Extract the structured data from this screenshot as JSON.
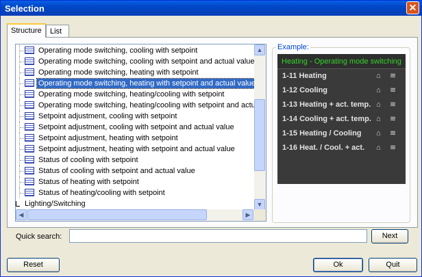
{
  "window": {
    "title": "Selection",
    "close_icon": "close-icon"
  },
  "tabs": [
    {
      "label": "Structure",
      "active": true
    },
    {
      "label": "List",
      "active": false
    }
  ],
  "tree": {
    "items": [
      {
        "label": "Operating mode switching, cooling with setpoint"
      },
      {
        "label": "Operating mode switching, cooling with setpoint and actual value"
      },
      {
        "label": "Operating mode switching, heating with setpoint"
      },
      {
        "label": "Operating mode switching, heating with setpoint and actual value",
        "selected": true
      },
      {
        "label": "Operating mode switching, heating/cooling with setpoint"
      },
      {
        "label": "Operating mode switching, heating/cooling with setpoint and actual value"
      },
      {
        "label": "Setpoint adjustment, cooling with setpoint"
      },
      {
        "label": "Setpoint adjustment, cooling with setpoint and actual value"
      },
      {
        "label": "Setpoint adjustment, heating with setpoint"
      },
      {
        "label": "Setpoint adjustment, heating with setpoint and actual value"
      },
      {
        "label": "Status of cooling with setpoint"
      },
      {
        "label": "Status of cooling with setpoint and actual value"
      },
      {
        "label": "Status of heating with setpoint"
      },
      {
        "label": "Status of heating/cooling with setpoint"
      }
    ],
    "group": {
      "label": "Lighting/Switching"
    },
    "item_icon": "function-block-icon"
  },
  "example": {
    "label": "Example:",
    "header": "Heating - Operating mode switching",
    "rows": [
      {
        "label": "1-11 Heating"
      },
      {
        "label": "1-12 Cooling"
      },
      {
        "label": "1-13 Heating + act. temp."
      },
      {
        "label": "1-14 Cooling + act. temp."
      },
      {
        "label": "1-15 Heating / Cooling"
      },
      {
        "label": "1-16 Heat. / Cool. + act."
      }
    ],
    "row_icons": [
      "house-icon",
      "heat-wave-icon"
    ]
  },
  "search": {
    "label": "Quick search:",
    "value": "",
    "next_label": "Next"
  },
  "footer": {
    "reset_label": "Reset",
    "ok_label": "Ok",
    "quit_label": "Quit"
  }
}
